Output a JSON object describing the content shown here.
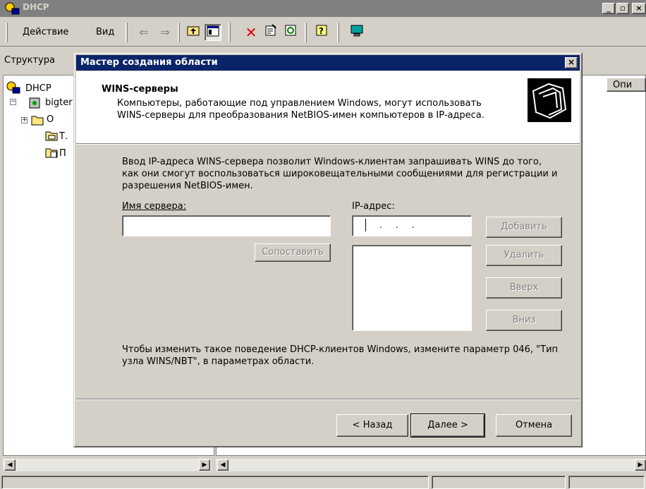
{
  "window": {
    "title": "DHCP"
  },
  "menu": {
    "action": "Действие",
    "view": "Вид"
  },
  "toolbar": {
    "icons": [
      "back-arrow-icon",
      "forward-arrow-icon",
      "up-folder-icon",
      "show-hide-tree-icon",
      "delete-icon",
      "properties-icon",
      "refresh-icon",
      "help-icon",
      "console-icon"
    ]
  },
  "tabs": {
    "structure": "Структура",
    "right_col": "Опи"
  },
  "tree": {
    "root": "DHCP",
    "server": "bigter",
    "children": [
      "О",
      "Т.",
      "П"
    ]
  },
  "dialog": {
    "title": "Мастер создания области",
    "header_title": "WINS-серверы",
    "header_desc": "Компьютеры, работающие под управлением Windows, могут использовать WINS-серверы для преобразования NetBIOS-имен компьютеров в IP-адреса.",
    "body_text": "Ввод IP-адреса WINS-сервера позволит Windows-клиентам запрашивать WINS до того, как они смогут воспользоваться широковещательными сообщениями для регистрации и разрешения NetBIOS-имен.",
    "server_name_label": "Имя сервера:",
    "server_name_value": "",
    "ip_label": "IP-адрес:",
    "ip_value": ".     .     .",
    "resolve_button": "Сопоставить",
    "add_button": "Добавить",
    "remove_button": "Удалить",
    "up_button": "Вверх",
    "down_button": "Вниз",
    "footer_text": "Чтобы изменить такое поведение DHCP-клиентов Windows, измените параметр 046, \"Тип узла WINS/NBT\", в параметрах области.",
    "back_button": "< Назад",
    "next_button": "Далее >",
    "cancel_button": "Отмена"
  },
  "colors": {
    "titlebar_active": "#0a246a",
    "titlebar_inactive": "#808080",
    "face": "#d4d0c8"
  }
}
